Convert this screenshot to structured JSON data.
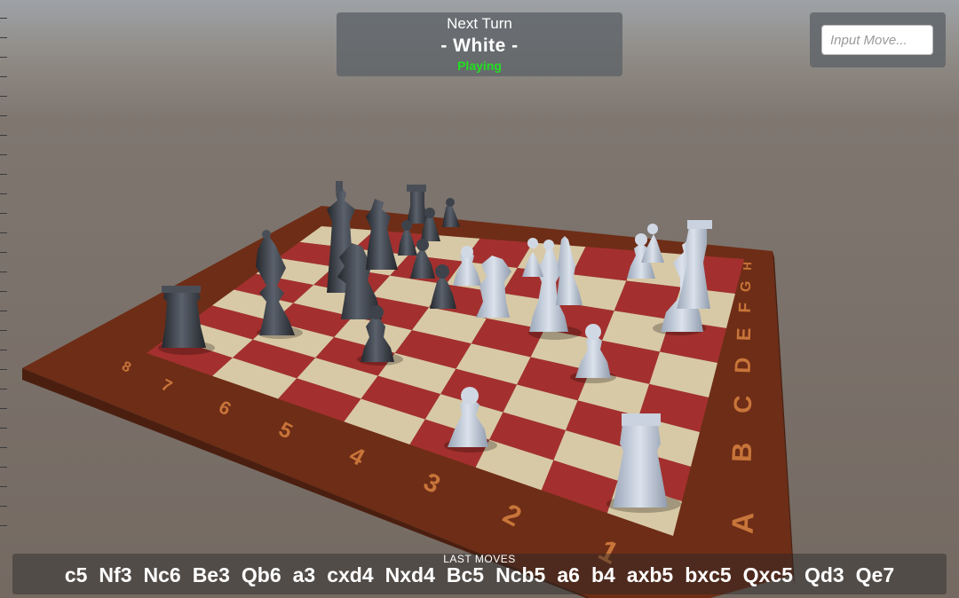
{
  "hud": {
    "next_turn_title": "Next Turn",
    "current_player": "- White -",
    "status": "Playing",
    "status_color": "#22e022"
  },
  "move_input": {
    "placeholder": "Input Move...",
    "value": ""
  },
  "last_moves": {
    "label": "LAST MOVES",
    "moves": [
      "c5",
      "Nf3",
      "Nc6",
      "Be3",
      "Qb6",
      "a3",
      "cxd4",
      "Nxd4",
      "Bc5",
      "Ncb5",
      "a6",
      "b4",
      "axb5",
      "bxc5",
      "Qxc5",
      "Qd3",
      "Qe7"
    ]
  },
  "board": {
    "rank_labels": [
      "8",
      "7",
      "6",
      "5",
      "4",
      "3",
      "2",
      "1"
    ],
    "file_labels": [
      "A",
      "B",
      "C",
      "D",
      "E",
      "F",
      "G",
      "H"
    ],
    "colors": {
      "light_square": "#d8c9a6",
      "dark_square": "#a3302e",
      "frame": "#6b2c14",
      "label": "#c8753a",
      "white_piece": "#b9c4d4",
      "black_piece": "#3c4048"
    }
  }
}
